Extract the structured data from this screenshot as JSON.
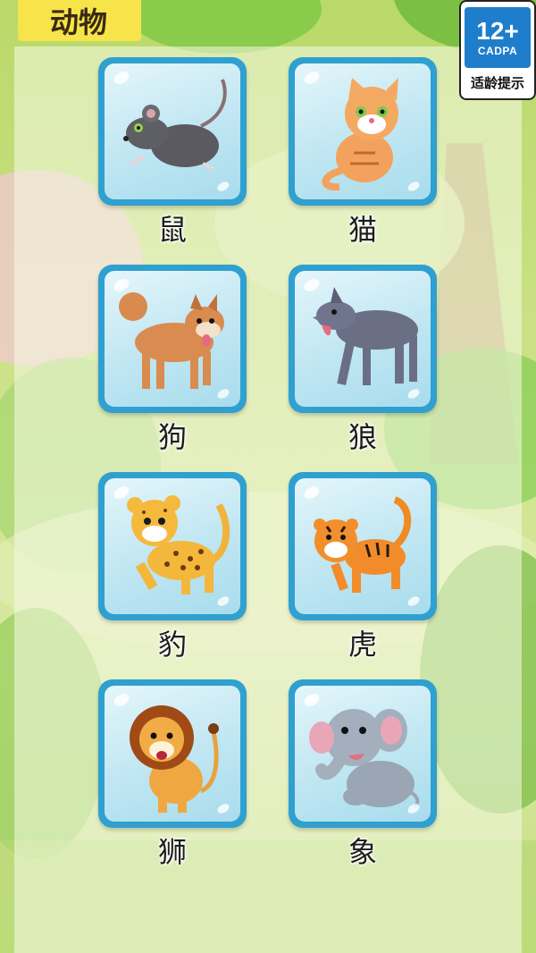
{
  "header": {
    "title": "动物"
  },
  "age_badge": {
    "rating": "12+",
    "org": "CADPA",
    "hint": "适龄提示"
  },
  "animals": [
    {
      "label": "鼠",
      "icon": "mouse-icon"
    },
    {
      "label": "猫",
      "icon": "cat-icon"
    },
    {
      "label": "狗",
      "icon": "dog-icon"
    },
    {
      "label": "狼",
      "icon": "wolf-icon"
    },
    {
      "label": "豹",
      "icon": "leopard-icon"
    },
    {
      "label": "虎",
      "icon": "tiger-icon"
    },
    {
      "label": "狮",
      "icon": "lion-icon"
    },
    {
      "label": "象",
      "icon": "elephant-icon"
    }
  ],
  "colors": {
    "card_border": "#2fa0cf",
    "title_tab": "#f6e44a",
    "badge_blue": "#1f7ecb"
  }
}
